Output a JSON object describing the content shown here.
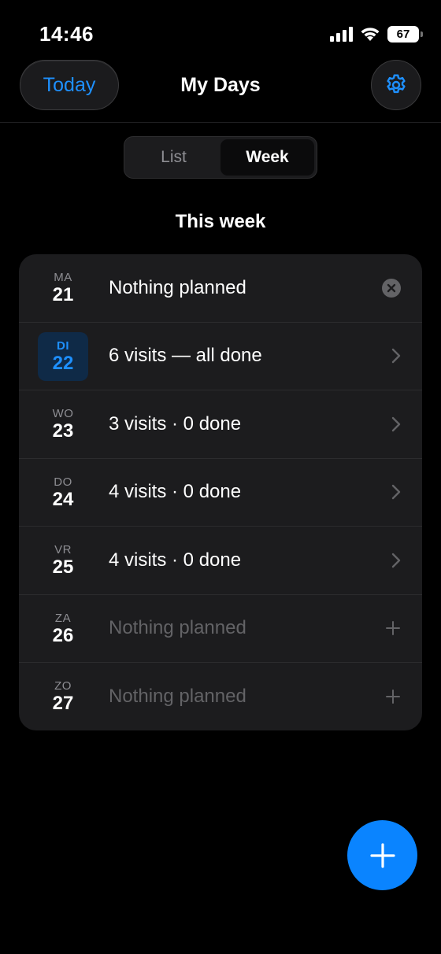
{
  "status": {
    "time": "14:46",
    "battery": "67"
  },
  "nav": {
    "today_label": "Today",
    "title": "My Days"
  },
  "segmented": {
    "options": [
      "List",
      "Week"
    ],
    "selected": "Week"
  },
  "section_title": "This week",
  "week": [
    {
      "dow": "MA",
      "day": "21",
      "label": "Nothing planned",
      "action": "clear-icon",
      "today": false,
      "muted": false
    },
    {
      "dow": "DI",
      "day": "22",
      "label": "6 visits — all done",
      "action": "chevron-right-icon",
      "today": true,
      "muted": false
    },
    {
      "dow": "WO",
      "day": "23",
      "label": "3 visits · 0 done",
      "action": "chevron-right-icon",
      "today": false,
      "muted": false
    },
    {
      "dow": "DO",
      "day": "24",
      "label": "4 visits · 0 done",
      "action": "chevron-right-icon",
      "today": false,
      "muted": false
    },
    {
      "dow": "VR",
      "day": "25",
      "label": "4 visits · 0 done",
      "action": "chevron-right-icon",
      "today": false,
      "muted": false
    },
    {
      "dow": "ZA",
      "day": "26",
      "label": "Nothing planned",
      "action": "plus-icon",
      "today": false,
      "muted": true
    },
    {
      "dow": "ZO",
      "day": "27",
      "label": "Nothing planned",
      "action": "plus-icon",
      "today": false,
      "muted": true
    }
  ],
  "colors": {
    "accent": "#0a84ff",
    "background": "#000000",
    "card": "#1c1c1e"
  }
}
